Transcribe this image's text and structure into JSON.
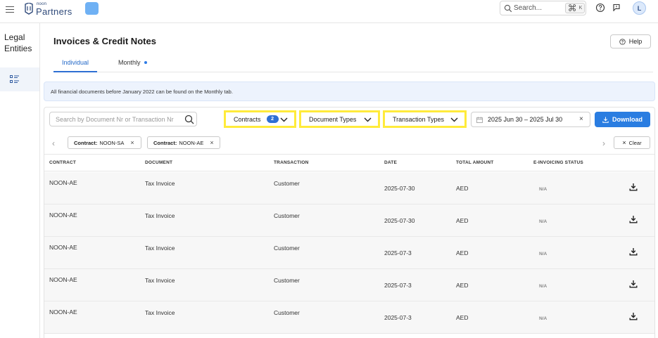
{
  "topbar": {
    "logo_small": "noon",
    "logo_main": "Partners",
    "search_placeholder": "Search...",
    "shortcut_key": "K",
    "avatar_initial": "L"
  },
  "sidebar": {
    "title": "Legal Entities",
    "items": [
      {
        "icon": "list-icon"
      }
    ]
  },
  "page": {
    "title": "Invoices & Credit Notes",
    "help_label": "Help",
    "tabs": [
      {
        "label": "Individual",
        "active": true
      },
      {
        "label": "Monthly",
        "active": false
      }
    ],
    "banner": "All financial documents before January 2022 can be found on the Monthly tab."
  },
  "filters": {
    "search_placeholder": "Search by Document Nr or Transaction Nr",
    "contracts_label": "Contracts",
    "contracts_count": "2",
    "document_types_label": "Document Types",
    "transaction_types_label": "Transaction Types",
    "date_range": "2025 Jun 30 – 2025 Jul 30",
    "download_label": "Download",
    "chips": [
      {
        "key": "Contract:",
        "value": "NOON-SA"
      },
      {
        "key": "Contract:",
        "value": "NOON-AE"
      }
    ],
    "clear_label": "Clear"
  },
  "table": {
    "headers": [
      "CONTRACT",
      "DOCUMENT",
      "TRANSACTION",
      "DATE",
      "TOTAL AMOUNT",
      "E-INVOICING STATUS"
    ],
    "rows": [
      {
        "contract": "NOON-AE",
        "document": "Tax Invoice",
        "transaction": "Customer",
        "date": "2025-07-30",
        "amount": "AED",
        "status": "N/A"
      },
      {
        "contract": "NOON-AE",
        "document": "Tax Invoice",
        "transaction": "Customer",
        "date": "2025-07-30",
        "amount": "AED",
        "status": "N/A"
      },
      {
        "contract": "NOON-AE",
        "document": "Tax Invoice",
        "transaction": "Customer",
        "date": "2025-07-3",
        "amount": "AED",
        "status": "N/A"
      },
      {
        "contract": "NOON-AE",
        "document": "Tax Invoice",
        "transaction": "Customer",
        "date": "2025-07-3",
        "amount": "AED",
        "status": "N/A"
      },
      {
        "contract": "NOON-AE",
        "document": "Tax Invoice",
        "transaction": "Customer",
        "date": "2025-07-3",
        "amount": "AED",
        "status": "N/A"
      }
    ]
  },
  "colors": {
    "accent": "#2a7de1",
    "highlight": "#ffeb3b",
    "banner_bg": "#edf3fd"
  }
}
